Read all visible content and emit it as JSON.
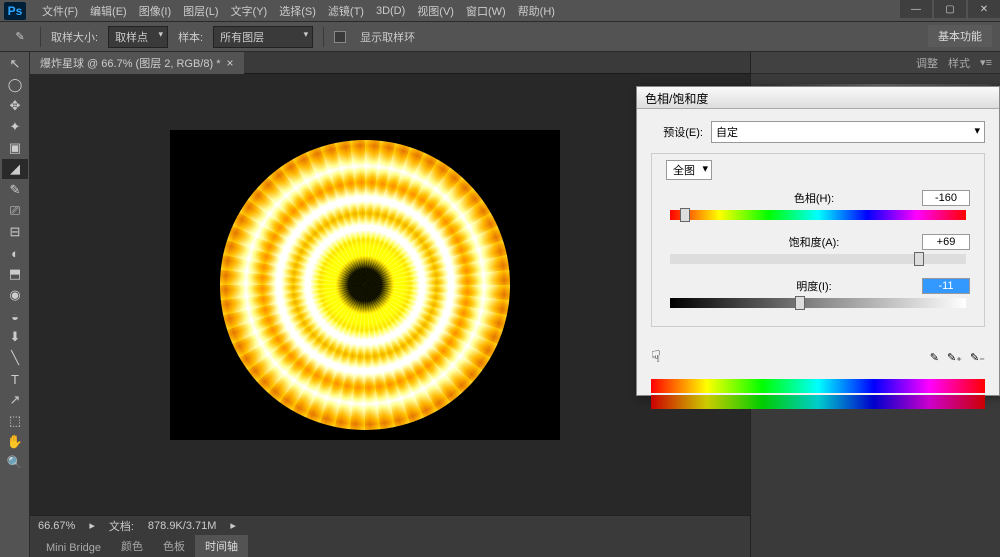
{
  "menu": {
    "file": "文件(F)",
    "edit": "编辑(E)",
    "image": "图像(I)",
    "layer": "图层(L)",
    "type": "文字(Y)",
    "select": "选择(S)",
    "filter": "滤镜(T)",
    "threed": "3D(D)",
    "view": "视图(V)",
    "window": "窗口(W)",
    "help": "帮助(H)"
  },
  "win": {
    "min": "—",
    "max": "▢",
    "close": "✕"
  },
  "options": {
    "sample_size_label": "取样大小:",
    "sample_size_value": "取样点",
    "sample_label": "样本:",
    "sample_value": "所有图层",
    "show_ring": "显示取样环",
    "essentials": "基本功能"
  },
  "tab": {
    "title": "爆炸星球 @ 66.7% (图层 2, RGB/8) *"
  },
  "status": {
    "zoom": "66.67%",
    "doc_label": "文档:",
    "doc_value": "878.9K/3.71M"
  },
  "panels": {
    "mini": "Mini Bridge",
    "color": "颜色",
    "swatch": "色板",
    "timeline": "时间轴",
    "adjust": "调整",
    "style": "样式"
  },
  "dialog": {
    "title": "色相/饱和度",
    "preset_label": "预设(E):",
    "preset_value": "自定",
    "channel": "全图",
    "hue_label": "色相(H):",
    "hue_value": "-160",
    "sat_label": "饱和度(A):",
    "sat_value": "+69",
    "light_label": "明度(I):",
    "light_value": "-11"
  },
  "tools": [
    "↖",
    "◯",
    "✥",
    "✦",
    "▣",
    "◢",
    "✎",
    "⎚",
    "⊟",
    "◐",
    "⬒",
    "◉",
    "◒",
    "⬇",
    "╲",
    "T",
    "↗",
    "⬚",
    "✋",
    "🔍"
  ]
}
